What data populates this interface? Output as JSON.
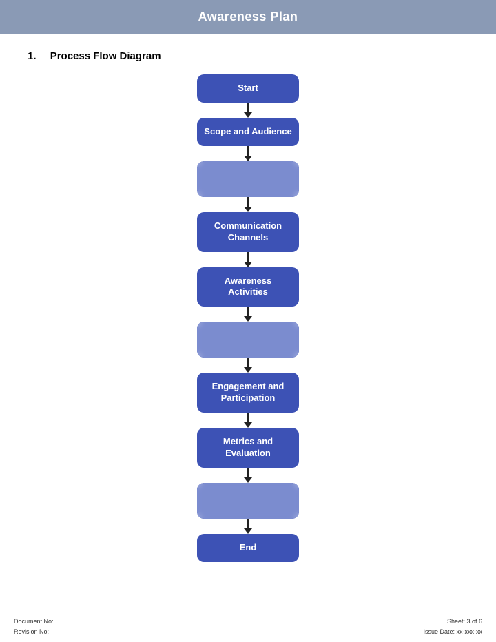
{
  "header": {
    "title": "Awareness Plan"
  },
  "section": {
    "number": "1.",
    "title": "Process Flow Diagram"
  },
  "flowNodes": [
    {
      "id": "start",
      "label": "Start",
      "type": "normal"
    },
    {
      "id": "scope",
      "label": "Scope and Audience",
      "type": "normal"
    },
    {
      "id": "blur1",
      "label": "",
      "type": "blur"
    },
    {
      "id": "channels",
      "label": "Communication\nChannels",
      "type": "normal"
    },
    {
      "id": "activities",
      "label": "Awareness\nActivities",
      "type": "normal"
    },
    {
      "id": "blur2",
      "label": "",
      "type": "blur"
    },
    {
      "id": "engagement",
      "label": "Engagement and\nParticipation",
      "type": "normal"
    },
    {
      "id": "metrics",
      "label": "Metrics and\nEvaluation",
      "type": "normal"
    },
    {
      "id": "blur3",
      "label": "",
      "type": "blur"
    },
    {
      "id": "end",
      "label": "End",
      "type": "normal"
    }
  ],
  "footer": {
    "document_no_label": "Document No:",
    "revision_no_label": "Revision No:",
    "sheet_label": "Sheet: 3 of 6",
    "issue_date_label": "Issue Date: xx-xxx-xx"
  }
}
